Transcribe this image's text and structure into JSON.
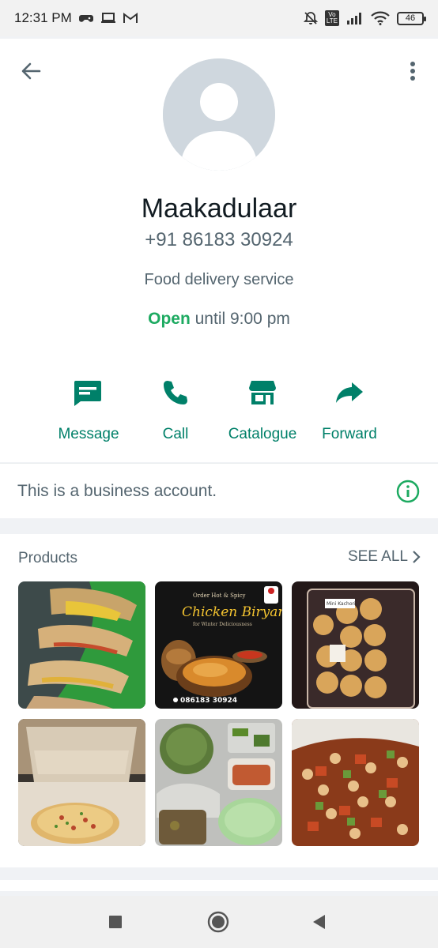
{
  "status_bar": {
    "time": "12:31 PM",
    "volte": "Vo\nLTE",
    "battery": "46"
  },
  "profile": {
    "name": "Maakadulaar",
    "phone": "+91 86183 30924",
    "category": "Food delivery service",
    "open_label": "Open",
    "hours_suffix": " until 9:00 pm"
  },
  "actions": [
    {
      "label": "Message",
      "icon": "message-icon"
    },
    {
      "label": "Call",
      "icon": "phone-icon"
    },
    {
      "label": "Catalogue",
      "icon": "storefront-icon"
    },
    {
      "label": "Forward",
      "icon": "forward-icon"
    }
  ],
  "business": {
    "text": "This is a business account."
  },
  "products": {
    "title": "Products",
    "see_all": "SEE ALL",
    "items": [
      {
        "name": "tacos"
      },
      {
        "name": "chicken-biryani",
        "poster": {
          "top": "Order Hot & Spicy",
          "title": "Chicken Biryani",
          "sub": "for Winter Deliciousness",
          "phone": "086183 30924"
        }
      },
      {
        "name": "pani-puri",
        "badge": "Mini Kachori"
      },
      {
        "name": "pizza"
      },
      {
        "name": "meal-box"
      },
      {
        "name": "chickpea-salad"
      }
    ]
  },
  "colors": {
    "accent": "#008069",
    "open": "#1daa61"
  }
}
